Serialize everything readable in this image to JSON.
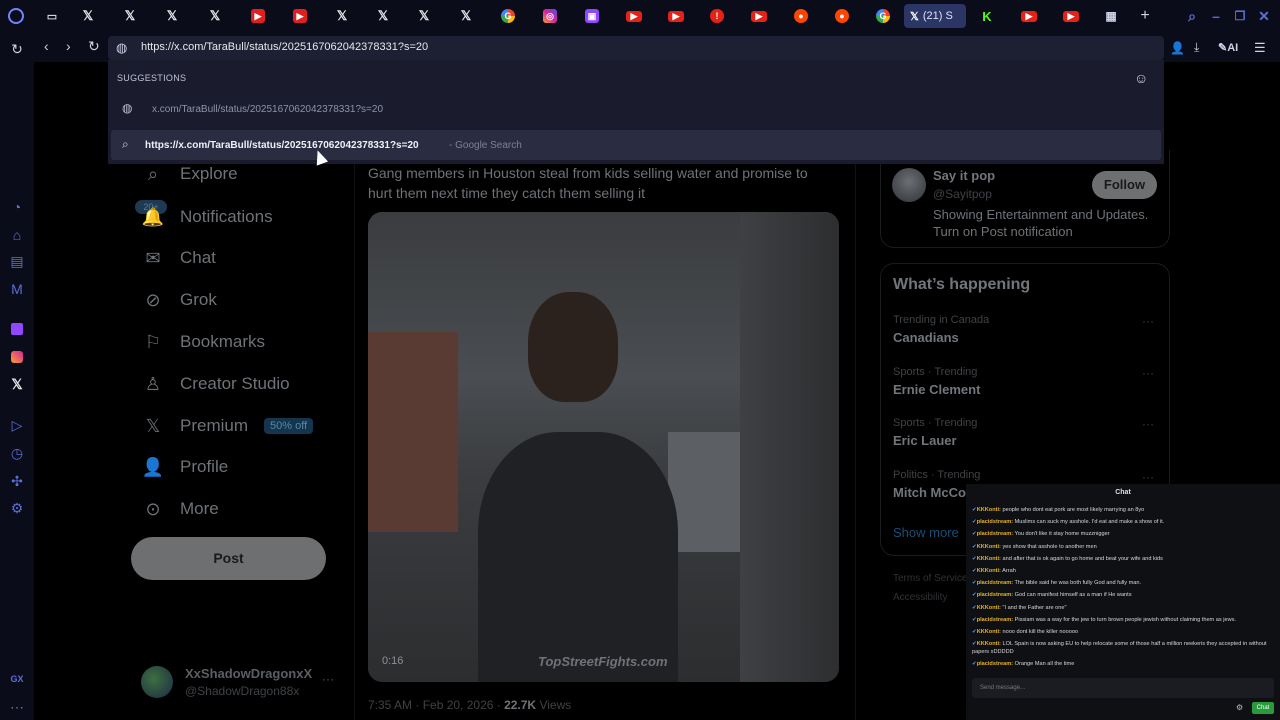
{
  "tabs": {
    "active_label": "(21) S"
  },
  "toolbar": {
    "ai_label": "AI"
  },
  "address": {
    "url": "https://x.com/TaraBull/status/2025167062042378331?s=20"
  },
  "suggestions": {
    "header": "SUGGESTIONS",
    "item1": "x.com/TaraBull/status/2025167062042378331?s=20",
    "item2_bold": "https://x.com/TaraBull/status/2025167062042378331?s=20",
    "item2_suffix": " - Google Search"
  },
  "left_nav": {
    "explore": "Explore",
    "notifications": "Notifications",
    "notif_badge": "20+",
    "chat": "Chat",
    "grok": "Grok",
    "bookmarks": "Bookmarks",
    "creator_studio": "Creator Studio",
    "premium": "Premium",
    "premium_badge": "50% off",
    "profile": "Profile",
    "more": "More",
    "post_button": "Post"
  },
  "account": {
    "name": "XxShadowDragonxX",
    "handle": "@ShadowDragon88x"
  },
  "tweet": {
    "text": "Gang members in Houston steal from kids selling water and promise to hurt them next time they catch them selling it",
    "video_time": "0:16",
    "watermark": "TopStreetFights.com",
    "timestamp": "7:35 AM · Feb 20, 2026 · ",
    "views_count": "22.7K",
    "views_label": " Views"
  },
  "who_to_follow": {
    "name": "Say it pop",
    "handle": "@Sayitpop",
    "bio": "Showing Entertainment and Updates. Turn on Post notification",
    "follow_label": "Follow"
  },
  "whats_happening": {
    "title": "What’s happening",
    "trends": [
      {
        "meta": "Trending in Canada",
        "name": "Canadians"
      },
      {
        "meta": "Sports · Trending",
        "name": "Ernie Clement"
      },
      {
        "meta": "Sports · Trending",
        "name": "Eric Lauer"
      },
      {
        "meta": "Politics · Trending",
        "name": "Mitch McCo"
      }
    ],
    "show_more": "Show more"
  },
  "footer": {
    "terms": "Terms of Service",
    "accessibility": "Accessibility"
  },
  "chat_overlay": {
    "title": "Chat",
    "input_placeholder": "Send message...",
    "send_label": "Chat",
    "messages": [
      {
        "user": "KKKonti:",
        "text": " people who dont eat pork are most likely marrying an 8yo"
      },
      {
        "user": "placidstream:",
        "text": " Muslims can suck my asshole. I'd eat and make a show of it."
      },
      {
        "user": "placidstream:",
        "text": " You don't like it stay home muzznigger"
      },
      {
        "user": "KKKonti:",
        "text": " yes show that asshole to another men"
      },
      {
        "user": "KKKonti:",
        "text": " and after that is ok again to go home and beat your wife and kids"
      },
      {
        "user": "KKKonti:",
        "text": " Arrah"
      },
      {
        "user": "placidstream:",
        "text": " The bible said he was both fully God and fully man."
      },
      {
        "user": "placidstream:",
        "text": " God can manifest himself as a man if He wants"
      },
      {
        "user": "KKKonti:",
        "text": " \"I and the Father are one\""
      },
      {
        "user": "placidstream:",
        "text": " Pissiam was a way for the jew to turn brown people jewish without claiming them as jews."
      },
      {
        "user": "KKKonti:",
        "text": " nooo dont kill the killer nooooo"
      },
      {
        "user": "KKKonti:",
        "text": " LOL Spain is now asking EU to help relocate some of those half a million neekeris they accepted in without papers xDDDDD"
      },
      {
        "user": "placidstream:",
        "text": " Orange Man all the time"
      }
    ]
  },
  "colors": {
    "accent": "#1d9bf0",
    "browser_bg": "#0b0c1a",
    "tab_icon_x": "#e7e9ea",
    "youtube_red": "#e62117"
  }
}
